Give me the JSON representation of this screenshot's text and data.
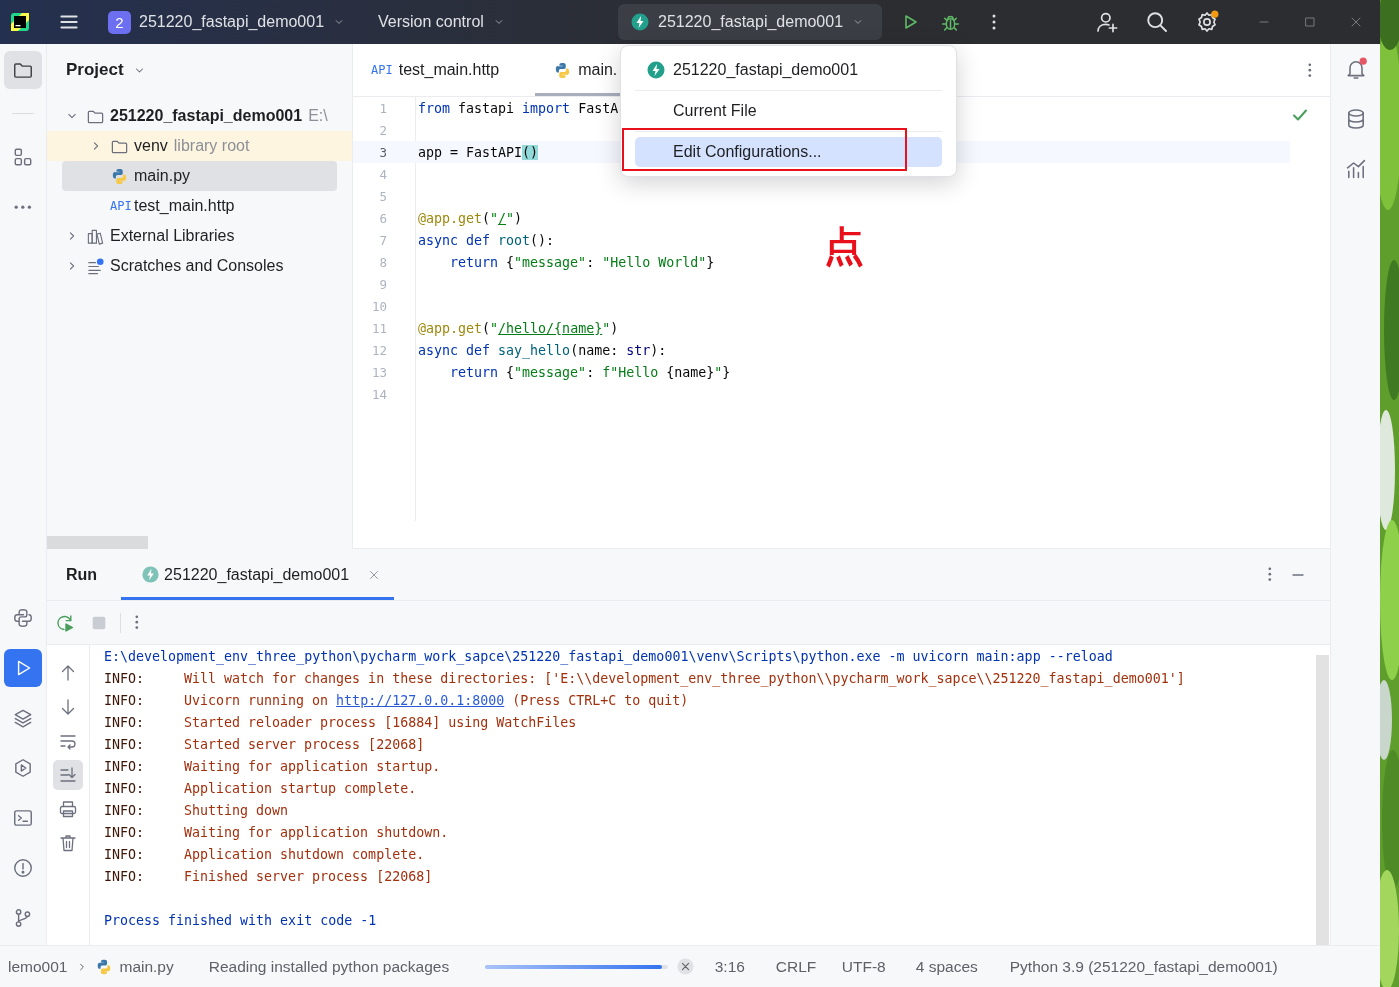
{
  "title_bar": {
    "project_badge": "2",
    "project_name": "251220_fastapi_demo001",
    "vcs_label": "Version control",
    "run_configuration": "251220_fastapi_demo001",
    "settings_update": true
  },
  "run_config_menu": {
    "items": [
      {
        "kind": "configuration",
        "label": "251220_fastapi_demo001",
        "selected": false,
        "framed": false
      },
      {
        "kind": "action",
        "label": "Current File",
        "selected": false,
        "framed": false
      },
      {
        "kind": "action",
        "label": "Edit Configurations...",
        "selected": true,
        "framed": true
      }
    ]
  },
  "annotation": {
    "text": "点"
  },
  "tool_strip": {
    "top": [
      {
        "kind": "project",
        "selected": true
      },
      {
        "kind": "structure",
        "selected": false
      },
      {
        "kind": "more",
        "selected": false
      }
    ],
    "bottom": [
      {
        "kind": "python-console",
        "selected": false
      },
      {
        "kind": "run",
        "selected": true
      },
      {
        "kind": "packages",
        "selected": false
      },
      {
        "kind": "services",
        "selected": false
      },
      {
        "kind": "terminal",
        "selected": false
      },
      {
        "kind": "problems",
        "selected": false
      },
      {
        "kind": "git",
        "selected": false
      }
    ]
  },
  "project_panel": {
    "title": "Project",
    "tree": [
      {
        "kind": "project",
        "label": "251220_fastapi_demo001",
        "hint": "E:\\",
        "expanded": true,
        "selected": false,
        "highlighted": false,
        "children": [
          {
            "kind": "folder",
            "label": "venv",
            "hint": "library root",
            "expanded": false,
            "selected": false,
            "highlighted": true
          },
          {
            "kind": "python",
            "label": "main.py",
            "selected": true,
            "highlighted": false
          },
          {
            "kind": "http",
            "type_label": "API",
            "label": "test_main.http",
            "selected": false,
            "highlighted": false
          }
        ]
      },
      {
        "kind": "library",
        "label": "External Libraries",
        "expanded": false,
        "selected": false,
        "highlighted": false
      },
      {
        "kind": "scratches",
        "label": "Scratches and Consoles",
        "expanded": false,
        "selected": false,
        "highlighted": false
      }
    ]
  },
  "editor": {
    "tabs": [
      {
        "kind": "http",
        "type_label": "API",
        "label": "test_main.http",
        "selected": false
      },
      {
        "kind": "python",
        "label": "main.",
        "selected": true
      }
    ],
    "inspection_ok": true,
    "lines": [
      {
        "number": "1",
        "current": false,
        "tokens": [
          {
            "kind": "keyword",
            "text": "from "
          },
          {
            "kind": "plain",
            "text": "fastapi "
          },
          {
            "kind": "keyword",
            "text": "import "
          },
          {
            "kind": "plain",
            "text": "FastA"
          }
        ]
      },
      {
        "number": "2",
        "current": false
      },
      {
        "number": "3",
        "current": true,
        "tokens": [
          {
            "kind": "plain",
            "text": "app = FastAPI"
          },
          {
            "kind": "match",
            "text": "()"
          }
        ]
      },
      {
        "number": "4",
        "current": false
      },
      {
        "number": "5",
        "current": false
      },
      {
        "number": "6",
        "current": false,
        "tokens": [
          {
            "kind": "decorator",
            "text": "@app.get"
          },
          {
            "kind": "plain",
            "text": "("
          },
          {
            "kind": "string",
            "text": "\""
          },
          {
            "kind": "url",
            "text": "/"
          },
          {
            "kind": "string",
            "text": "\""
          },
          {
            "kind": "plain",
            "text": ")"
          }
        ]
      },
      {
        "number": "7",
        "current": false,
        "tokens": [
          {
            "kind": "keyword",
            "text": "async def "
          },
          {
            "kind": "function",
            "text": "root"
          },
          {
            "kind": "plain",
            "text": "():"
          }
        ]
      },
      {
        "number": "8",
        "current": false,
        "tokens": [
          {
            "kind": "keyword",
            "text": "    return "
          },
          {
            "kind": "plain",
            "text": "{"
          },
          {
            "kind": "string",
            "text": "\"message\""
          },
          {
            "kind": "plain",
            "text": ": "
          },
          {
            "kind": "string",
            "text": "\"Hello World\""
          },
          {
            "kind": "plain",
            "text": "}"
          }
        ]
      },
      {
        "number": "9",
        "current": false
      },
      {
        "number": "10",
        "current": false
      },
      {
        "number": "11",
        "current": false,
        "tokens": [
          {
            "kind": "decorator",
            "text": "@app.get"
          },
          {
            "kind": "plain",
            "text": "("
          },
          {
            "kind": "string",
            "text": "\""
          },
          {
            "kind": "url",
            "text": "/hello/{name}"
          },
          {
            "kind": "string",
            "text": "\""
          },
          {
            "kind": "plain",
            "text": ")"
          }
        ]
      },
      {
        "number": "12",
        "current": false,
        "tokens": [
          {
            "kind": "keyword",
            "text": "async def "
          },
          {
            "kind": "function",
            "text": "say_hello"
          },
          {
            "kind": "plain",
            "text": "(name: "
          },
          {
            "kind": "builtin",
            "text": "str"
          },
          {
            "kind": "plain",
            "text": "):"
          }
        ]
      },
      {
        "number": "13",
        "current": false,
        "tokens": [
          {
            "kind": "keyword",
            "text": "    return "
          },
          {
            "kind": "plain",
            "text": "{"
          },
          {
            "kind": "string",
            "text": "\"message\""
          },
          {
            "kind": "plain",
            "text": ": "
          },
          {
            "kind": "string",
            "text": "f\"Hello "
          },
          {
            "kind": "plain",
            "text": "{name}"
          },
          {
            "kind": "string",
            "text": "\""
          },
          {
            "kind": "plain",
            "text": "}"
          }
        ]
      },
      {
        "number": "14",
        "current": false
      }
    ]
  },
  "run_panel": {
    "title": "Run",
    "tabs": [
      {
        "label": "251220_fastapi_demo001",
        "selected": true
      }
    ],
    "stop_enabled": false,
    "console_toolbar": [
      {
        "kind": "up",
        "on": false
      },
      {
        "kind": "down",
        "on": false
      },
      {
        "kind": "wrap",
        "on": false
      },
      {
        "kind": "scroll-end",
        "on": true
      },
      {
        "kind": "print",
        "on": false
      },
      {
        "kind": "clear",
        "on": false
      }
    ],
    "console": [
      {
        "kind": "command",
        "text": "E:\\development_env_three_python\\pycharm_work_sapce\\251220_fastapi_demo001\\venv\\Scripts\\python.exe -m uvicorn main:app --reload"
      },
      {
        "kind": "info",
        "level": "INFO:",
        "text": "Will watch for changes in these directories: ['E:\\\\development_env_three_python\\\\pycharm_work_sapce\\\\251220_fastapi_demo001']"
      },
      {
        "kind": "info",
        "level": "INFO:",
        "text": "Uvicorn running on ",
        "link": "http://127.0.0.1:8000",
        "after": " (Press CTRL+C to quit)"
      },
      {
        "kind": "info",
        "level": "INFO:",
        "text": "Started reloader process [16884] using WatchFiles"
      },
      {
        "kind": "info",
        "level": "INFO:",
        "text": "Started server process [22068]"
      },
      {
        "kind": "info",
        "level": "INFO:",
        "text": "Waiting for application startup."
      },
      {
        "kind": "info",
        "level": "INFO:",
        "text": "Application startup complete."
      },
      {
        "kind": "info",
        "level": "INFO:",
        "text": "Shutting down"
      },
      {
        "kind": "info",
        "level": "INFO:",
        "text": "Waiting for application shutdown."
      },
      {
        "kind": "info",
        "level": "INFO:",
        "text": "Application shutdown complete."
      },
      {
        "kind": "info",
        "level": "INFO:",
        "text": "Finished server process [22068]"
      },
      {
        "kind": "exit",
        "text": "Process finished with exit code -1"
      }
    ]
  },
  "right_strip": [
    {
      "kind": "notifications",
      "unread": true
    },
    {
      "kind": "database",
      "unread": false
    },
    {
      "kind": "profiler",
      "unread": false
    }
  ],
  "status_bar": {
    "breadcrumbs": [
      {
        "kind": "folder",
        "label": "lemo001"
      },
      {
        "kind": "python",
        "label": "main.py"
      }
    ],
    "task": "Reading installed python packages",
    "progress": {
      "level": 0.97
    },
    "caret": "3:16",
    "line_separator": "CRLF",
    "encoding": "UTF-8",
    "indent": "4 spaces",
    "interpreter": "Python 3.9 (251220_fastapi_demo001)"
  }
}
